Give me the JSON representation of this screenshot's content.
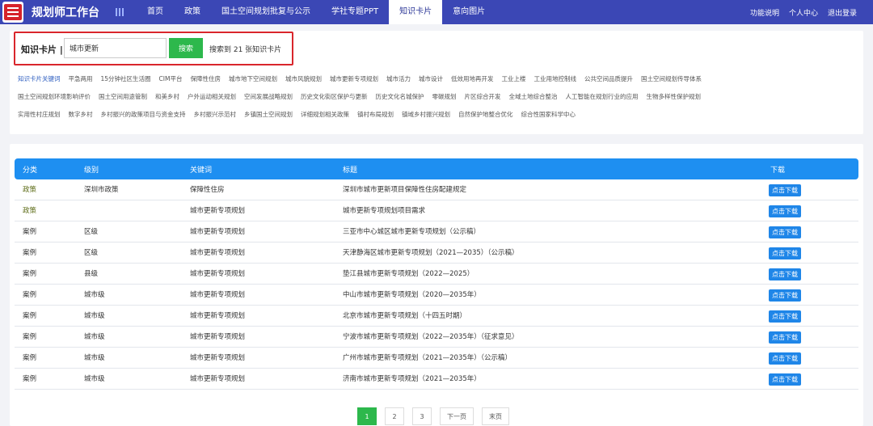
{
  "app": {
    "title": "规划师工作台"
  },
  "nav": {
    "items": [
      {
        "label": "首页"
      },
      {
        "label": "政策"
      },
      {
        "label": "国土空间规划批复与公示"
      },
      {
        "label": "学社专题PPT"
      },
      {
        "label": "知识卡片",
        "active": true
      },
      {
        "label": "意向图片"
      }
    ]
  },
  "top_right": {
    "help": "功能说明",
    "profile": "个人中心",
    "logout": "退出登录"
  },
  "search": {
    "label": "知识卡片 |",
    "value": "城市更新",
    "button": "搜索",
    "result": "搜索到 21 张知识卡片"
  },
  "tags": {
    "row1": [
      "知识卡片关键词",
      "平急两用",
      "15分钟社区生活圈",
      "CIM平台",
      "保障性住房",
      "城市地下空间规划",
      "城市风貌规划",
      "城市更新专项规划",
      "城市活力",
      "城市设计",
      "低效用地再开发",
      "工业上楼",
      "工业用地控制线",
      "公共空间品质提升",
      "国土空间规划传导体系"
    ],
    "row2": [
      "国土空间规划环境影响评价",
      "国土空间用途管制",
      "和美乡村",
      "户外运动相关规划",
      "空间发展战略规划",
      "历史文化街区保护与更新",
      "历史文化名城保护",
      "零碳规划",
      "片区综合开发",
      "全域土地综合整治",
      "人工智能在规划行业的应用",
      "生物多样性保护规划"
    ],
    "row3": [
      "实用性村庄规划",
      "数字乡村",
      "乡村振兴的政策项目与资金支持",
      "乡村振兴示范村",
      "乡镇国土空间规划",
      "详细规划相关政策",
      "镇村布局规划",
      "镇域乡村振兴规划",
      "自然保护地整合优化",
      "综合性国家科学中心"
    ]
  },
  "table": {
    "headers": {
      "category": "分类",
      "level": "级别",
      "keyword": "关键词",
      "title": "标题",
      "download": "下载"
    },
    "rows": [
      {
        "category": "政策",
        "level": "深圳市政策",
        "keyword": "保障性住房",
        "title": "深圳市城市更新项目保障性住房配建规定",
        "download": "点击下载"
      },
      {
        "category": "政策",
        "level": "",
        "keyword": "城市更新专项规划",
        "title": "城市更新专项规划项目需求",
        "download": "点击下载"
      },
      {
        "category": "案例",
        "level": "区级",
        "keyword": "城市更新专项规划",
        "title": "三亚市中心城区城市更新专项规划（公示稿）",
        "download": "点击下载"
      },
      {
        "category": "案例",
        "level": "区级",
        "keyword": "城市更新专项规划",
        "title": "天津静海区城市更新专项规划（2021—2035）（公示稿）",
        "download": "点击下载"
      },
      {
        "category": "案例",
        "level": "县级",
        "keyword": "城市更新专项规划",
        "title": "垫江县城市更新专项规划（2022—2025）",
        "download": "点击下载"
      },
      {
        "category": "案例",
        "level": "城市级",
        "keyword": "城市更新专项规划",
        "title": "中山市城市更新专项规划（2020—2035年）",
        "download": "点击下载"
      },
      {
        "category": "案例",
        "level": "城市级",
        "keyword": "城市更新专项规划",
        "title": "北京市城市更新专项规划（十四五时期）",
        "download": "点击下载"
      },
      {
        "category": "案例",
        "level": "城市级",
        "keyword": "城市更新专项规划",
        "title": "宁波市城市更新专项规划（2022—2035年）（征求意见）",
        "download": "点击下载"
      },
      {
        "category": "案例",
        "level": "城市级",
        "keyword": "城市更新专项规划",
        "title": "广州市城市更新专项规划（2021—2035年）（公示稿）",
        "download": "点击下载"
      },
      {
        "category": "案例",
        "level": "城市级",
        "keyword": "城市更新专项规划",
        "title": "济南市城市更新专项规划（2021—2035年）",
        "download": "点击下载"
      }
    ]
  },
  "pager": {
    "pages": [
      "1",
      "2",
      "3"
    ],
    "next": "下一页",
    "last": "末页"
  },
  "colors": {
    "nav_bg": "#3b47b5",
    "accent_green": "#2db84c",
    "table_head": "#1e8ff1",
    "highlight_red": "#d9262c"
  }
}
